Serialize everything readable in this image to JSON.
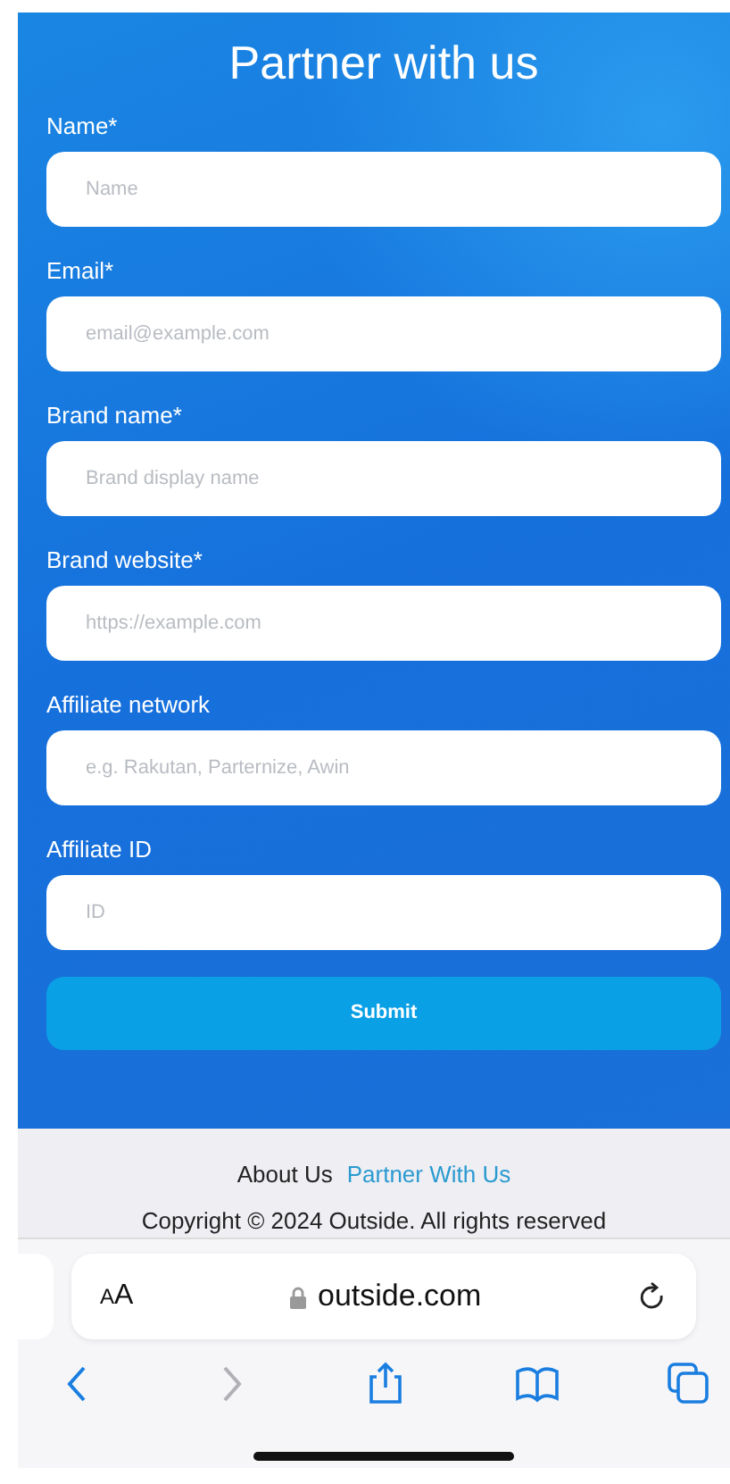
{
  "form": {
    "title": "Partner with us",
    "fields": [
      {
        "label": "Name*",
        "placeholder": "Name"
      },
      {
        "label": "Email*",
        "placeholder": "email@example.com"
      },
      {
        "label": "Brand name*",
        "placeholder": "Brand display name"
      },
      {
        "label": "Brand website*",
        "placeholder": "https://example.com"
      },
      {
        "label": "Affiliate network",
        "placeholder": "e.g. Rakutan, Parternize, Awin"
      },
      {
        "label": "Affiliate ID",
        "placeholder": "ID"
      }
    ],
    "submit": "Submit"
  },
  "footer": {
    "links": [
      {
        "label": "About Us",
        "highlighted": false
      },
      {
        "label": "Partner With Us",
        "highlighted": true
      }
    ],
    "copyright": "Copyright © 2024 Outside. All rights reserved"
  },
  "browser": {
    "text_size": "AA",
    "url": "outside.com",
    "toolbar": [
      {
        "kind": "back",
        "disabled": false
      },
      {
        "kind": "forward",
        "disabled": true
      },
      {
        "kind": "share",
        "disabled": false
      },
      {
        "kind": "bookmarks",
        "disabled": false
      },
      {
        "kind": "tabs",
        "disabled": false
      }
    ]
  }
}
